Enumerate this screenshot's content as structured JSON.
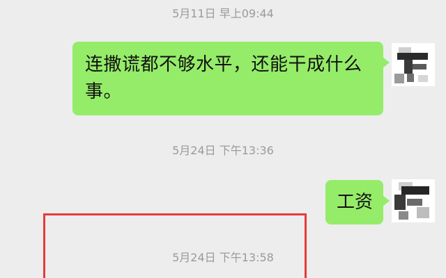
{
  "timestamps": [
    "5月11日 早上09:44",
    "5月24日 下午13:36",
    "5月24日 下午13:58"
  ],
  "messages": [
    {
      "sender": "self",
      "text": "连撒谎都不够水平，还能干成什么事。"
    },
    {
      "sender": "self",
      "text": "工资"
    }
  ],
  "colors": {
    "background": "#ededed",
    "bubble": "#95ec69",
    "highlight": "#e43b38"
  }
}
